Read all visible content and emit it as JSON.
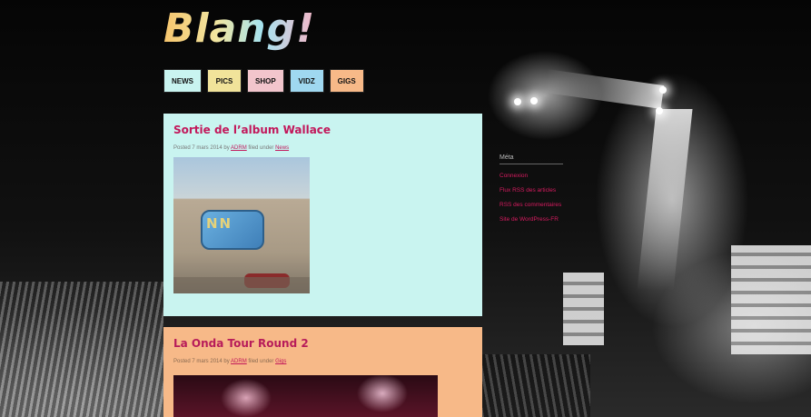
{
  "site": {
    "logo_text": "Blang!"
  },
  "nav": {
    "items": [
      {
        "label": "NEWS",
        "color": "#c9f4f0"
      },
      {
        "label": "PICS",
        "color": "#f1e39a"
      },
      {
        "label": "SHOP",
        "color": "#f2c5cc"
      },
      {
        "label": "VIDZ",
        "color": "#9fd8f0"
      },
      {
        "label": "GIGS",
        "color": "#f7b988"
      }
    ]
  },
  "posts": [
    {
      "title": "Sortie de l’album Wallace",
      "meta_prefix": "Posted 7 mars 2014 by ",
      "author": "ADRM",
      "meta_mid": " filed under ",
      "category": "News",
      "bg_color": "#c9f4f0"
    },
    {
      "title": "La Onda Tour Round 2",
      "meta_prefix": "Posted 7 mars 2014 by ",
      "author": "ADRM",
      "meta_mid": " filed under ",
      "category": "Gigs",
      "bg_color": "#f7b988"
    }
  ],
  "sidebar": {
    "title": "Méta",
    "links": [
      "Connexion",
      "Flux RSS des articles",
      "RSS des commentaires",
      "Site de WordPress-FR"
    ]
  },
  "colors": {
    "accent": "#c2185b",
    "background": "#0a0a0a"
  }
}
